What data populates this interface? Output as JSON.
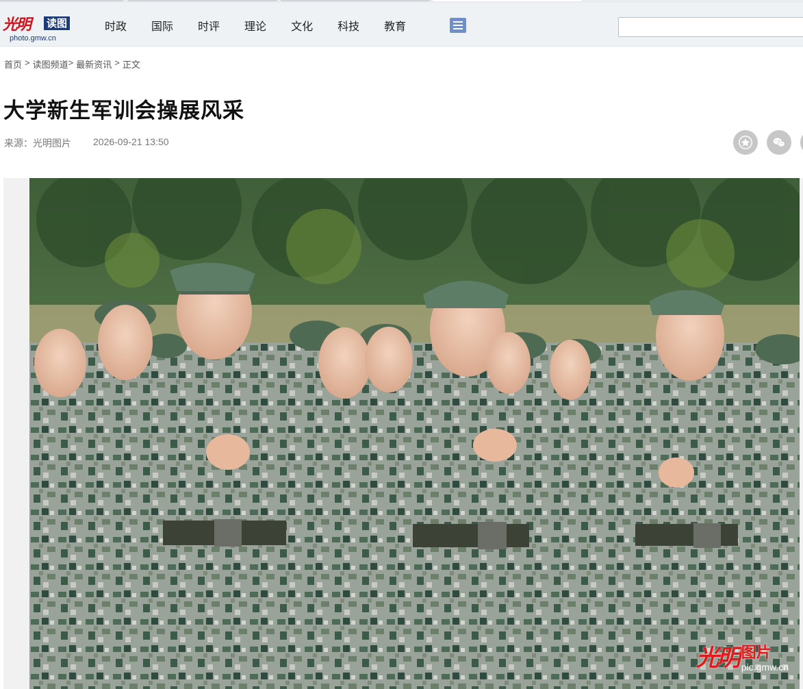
{
  "header": {
    "logo_mark": "光明",
    "logo_box": "读图",
    "logo_url": "photo.gmw.cn",
    "nav": [
      "时政",
      "国际",
      "时评",
      "理论",
      "文化",
      "科技",
      "教育"
    ],
    "search_placeholder": ""
  },
  "breadcrumb": {
    "items": [
      "首页",
      "读图频道",
      "最新资讯",
      "正文"
    ],
    "separators": [
      ">",
      ">",
      ">"
    ]
  },
  "article": {
    "title": "大学新生军训会操展风采",
    "source": "来源：光明图片",
    "date": "2026-09-21 13:50"
  },
  "share": {
    "icons": [
      "favorite-star-icon",
      "wechat-icon"
    ],
    "color": "#c7c7c7"
  },
  "photo": {
    "watermark_mark": "光明",
    "watermark_word": "图片",
    "watermark_url": "pic.gmw.cn"
  },
  "colors": {
    "brand_red": "#d0121b",
    "brand_blue": "#1d3b78",
    "header_bg": "#eef2f5"
  }
}
